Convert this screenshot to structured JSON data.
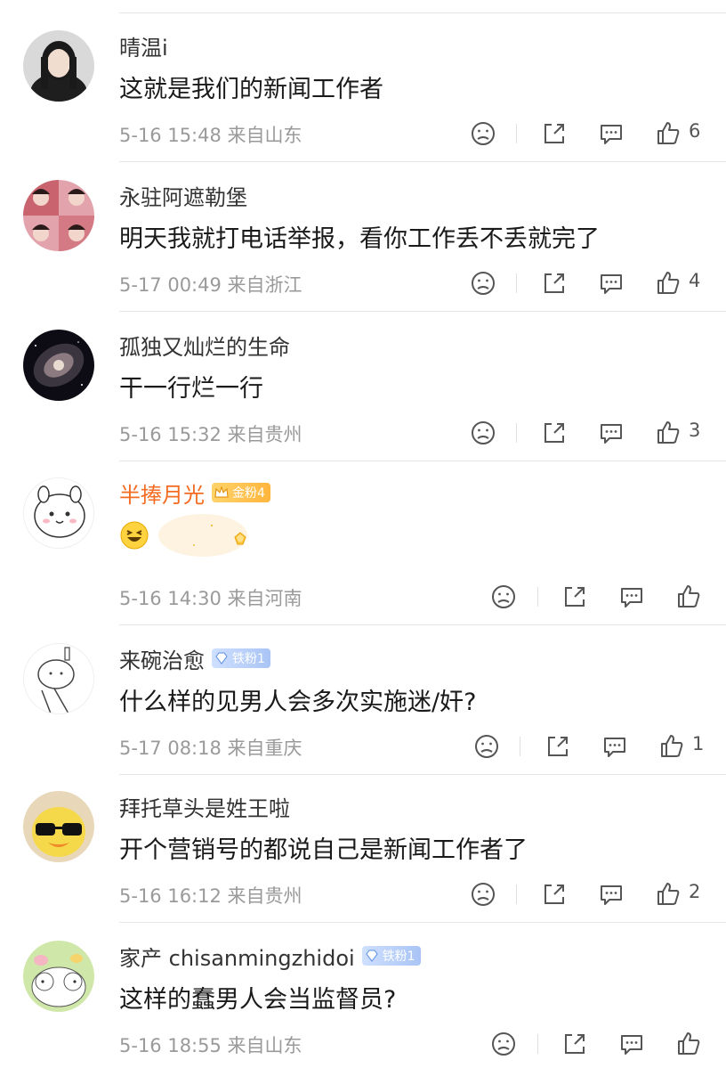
{
  "comments": [
    {
      "user": "晴温i",
      "badge": null,
      "text": "这就是我们的新闻工作者",
      "time": "5-16 15:48",
      "location": "来自山东",
      "likes": "6"
    },
    {
      "user": "永驻阿遮勒堡",
      "badge": null,
      "text": "明天我就打电话举报，看你工作丢不丢就完了",
      "time": "5-17 00:49",
      "location": "来自浙江",
      "likes": "4"
    },
    {
      "user": "孤独又灿烂的生命",
      "badge": null,
      "text": "干一行烂一行",
      "time": "5-16 15:32",
      "location": "来自贵州",
      "likes": "3"
    },
    {
      "user": "半捧月光",
      "badge": "金粉4",
      "text": "",
      "time": "5-16 14:30",
      "location": "来自河南",
      "likes": ""
    },
    {
      "user": "来碗治愈",
      "badge": "铁粉1",
      "text": "什么样的见男人会多次实施迷/奸?",
      "time": "5-17 08:18",
      "location": "来自重庆",
      "likes": "1"
    },
    {
      "user": "拜托草头是姓王啦",
      "badge": null,
      "text": "开个营销号的都说自己是新闻工作者了",
      "time": "5-16 16:12",
      "location": "来自贵州",
      "likes": "2"
    },
    {
      "user": "家产 chisanmingzhidoi",
      "badge": "铁粉1",
      "text": "这样的蠢男人会当监督员?",
      "time": "5-16 18:55",
      "location": "来自山东",
      "likes": ""
    }
  ],
  "colors": {
    "accent_orange": "#f36c21",
    "meta_gray": "#9a9a9a"
  },
  "icons": [
    "dislike-icon",
    "share-icon",
    "comment-icon",
    "like-icon"
  ]
}
